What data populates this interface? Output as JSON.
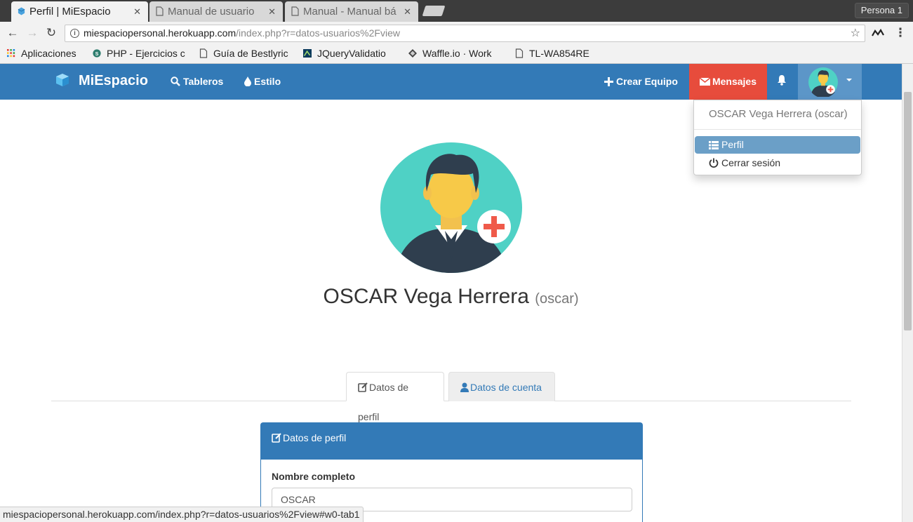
{
  "browser": {
    "tabs": [
      {
        "label": "Perfil | MiEspacio",
        "active": true
      },
      {
        "label": "Manual de usuario",
        "active": false
      },
      {
        "label": "Manual - Manual bá",
        "active": false
      }
    ],
    "close_glyph": "✕",
    "profile_label": "Persona 1",
    "url_host": "miespaciopersonal.herokuapp.com",
    "url_path": "/index.php?r=datos-usuarios%2Fview",
    "bookmarks": [
      {
        "label": "Aplicaciones",
        "icon": "apps-grid-icon"
      },
      {
        "label": "PHP - Ejercicios c",
        "icon": "php-site-icon"
      },
      {
        "label": "Guía de Bestlyric",
        "icon": "page-icon"
      },
      {
        "label": "JQueryValidatio",
        "icon": "jquery-icon"
      },
      {
        "label": "Waffle.io · Work",
        "icon": "waffle-icon"
      },
      {
        "label": "TL-WA854RE",
        "icon": "page-icon"
      }
    ],
    "status_url": "miespaciopersonal.herokuapp.com/index.php?r=datos-usuarios%2Fview#w0-tab1"
  },
  "navbar": {
    "brand": "MiEspacio",
    "links": [
      {
        "label": "Tableros",
        "icon": "search-icon"
      },
      {
        "label": "Estilo",
        "icon": "tint-icon"
      }
    ],
    "crear_equipo": "Crear Equipo",
    "mensajes": "Mensajes",
    "colors": {
      "primary": "#337ab7",
      "danger": "#e74c3c",
      "user_btn": "#5c96c8"
    }
  },
  "dropdown": {
    "header": "OSCAR Vega Herrera (oscar)",
    "items": [
      {
        "label": "Perfil",
        "icon": "list-icon",
        "active": true
      },
      {
        "label": "Cerrar sesión",
        "icon": "power-icon",
        "active": false
      }
    ]
  },
  "profile": {
    "name": "OSCAR Vega Herrera",
    "username": "(oscar)",
    "tabs": [
      {
        "label": "Datos de perfil",
        "icon": "edit-icon",
        "active": true
      },
      {
        "label": "Datos de cuenta",
        "icon": "user-icon",
        "active": false
      }
    ],
    "panel_title": "Datos de perfil",
    "field_label": "Nombre completo",
    "field_value": "OSCAR"
  }
}
